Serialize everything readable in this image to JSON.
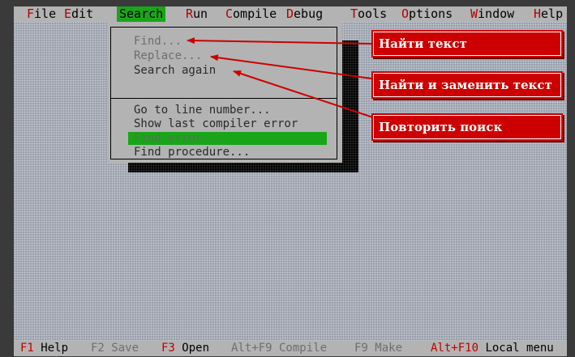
{
  "menubar": {
    "items": [
      {
        "hotkey": "F",
        "rest": "ile"
      },
      {
        "hotkey": "E",
        "rest": "dit"
      },
      {
        "hotkey": "S",
        "rest": "earch"
      },
      {
        "hotkey": "R",
        "rest": "un"
      },
      {
        "hotkey": "C",
        "rest": "ompile"
      },
      {
        "hotkey": "D",
        "rest": "ebug"
      },
      {
        "hotkey": "T",
        "rest": "ools"
      },
      {
        "hotkey": "O",
        "rest": "ptions"
      },
      {
        "hotkey": "W",
        "rest": "indow"
      },
      {
        "hotkey": "H",
        "rest": "elp"
      }
    ],
    "active_item": "Search"
  },
  "search_menu": {
    "items": [
      {
        "label": "Find...",
        "state": "disabled"
      },
      {
        "label": "Replace...",
        "state": "disabled"
      },
      {
        "label": "Search again",
        "state": "enabled"
      },
      {
        "label": "Go to line number...",
        "state": "enabled"
      },
      {
        "label": "Show last compiler error",
        "state": "enabled"
      },
      {
        "label": "Find error...",
        "state": "disabled-highlighted"
      },
      {
        "label": "Find procedure...",
        "state": "enabled"
      }
    ]
  },
  "statusbar": {
    "items": [
      {
        "key": "F1",
        "text": " Help",
        "state": "enabled"
      },
      {
        "key": "F2",
        "text": " Save",
        "state": "disabled"
      },
      {
        "key": "F3",
        "text": " Open",
        "state": "enabled"
      },
      {
        "key": "Alt+F9",
        "text": " Compile",
        "state": "disabled"
      },
      {
        "key": "F9",
        "text": " Make",
        "state": "disabled"
      },
      {
        "key": "Alt+F10",
        "text": " Local menu",
        "state": "enabled"
      }
    ]
  },
  "callouts": [
    {
      "label": "Найти текст",
      "points_to": "Find..."
    },
    {
      "label": "Найти и заменить текст",
      "points_to": "Replace..."
    },
    {
      "label": "Повторить поиск",
      "points_to": "Search again"
    }
  ],
  "colors": {
    "menu_bg": "#b3b3b3",
    "highlight": "#18a618",
    "hotkey": "#b00000",
    "callout": "#cc0000",
    "desktop": "#9aa0ab"
  }
}
